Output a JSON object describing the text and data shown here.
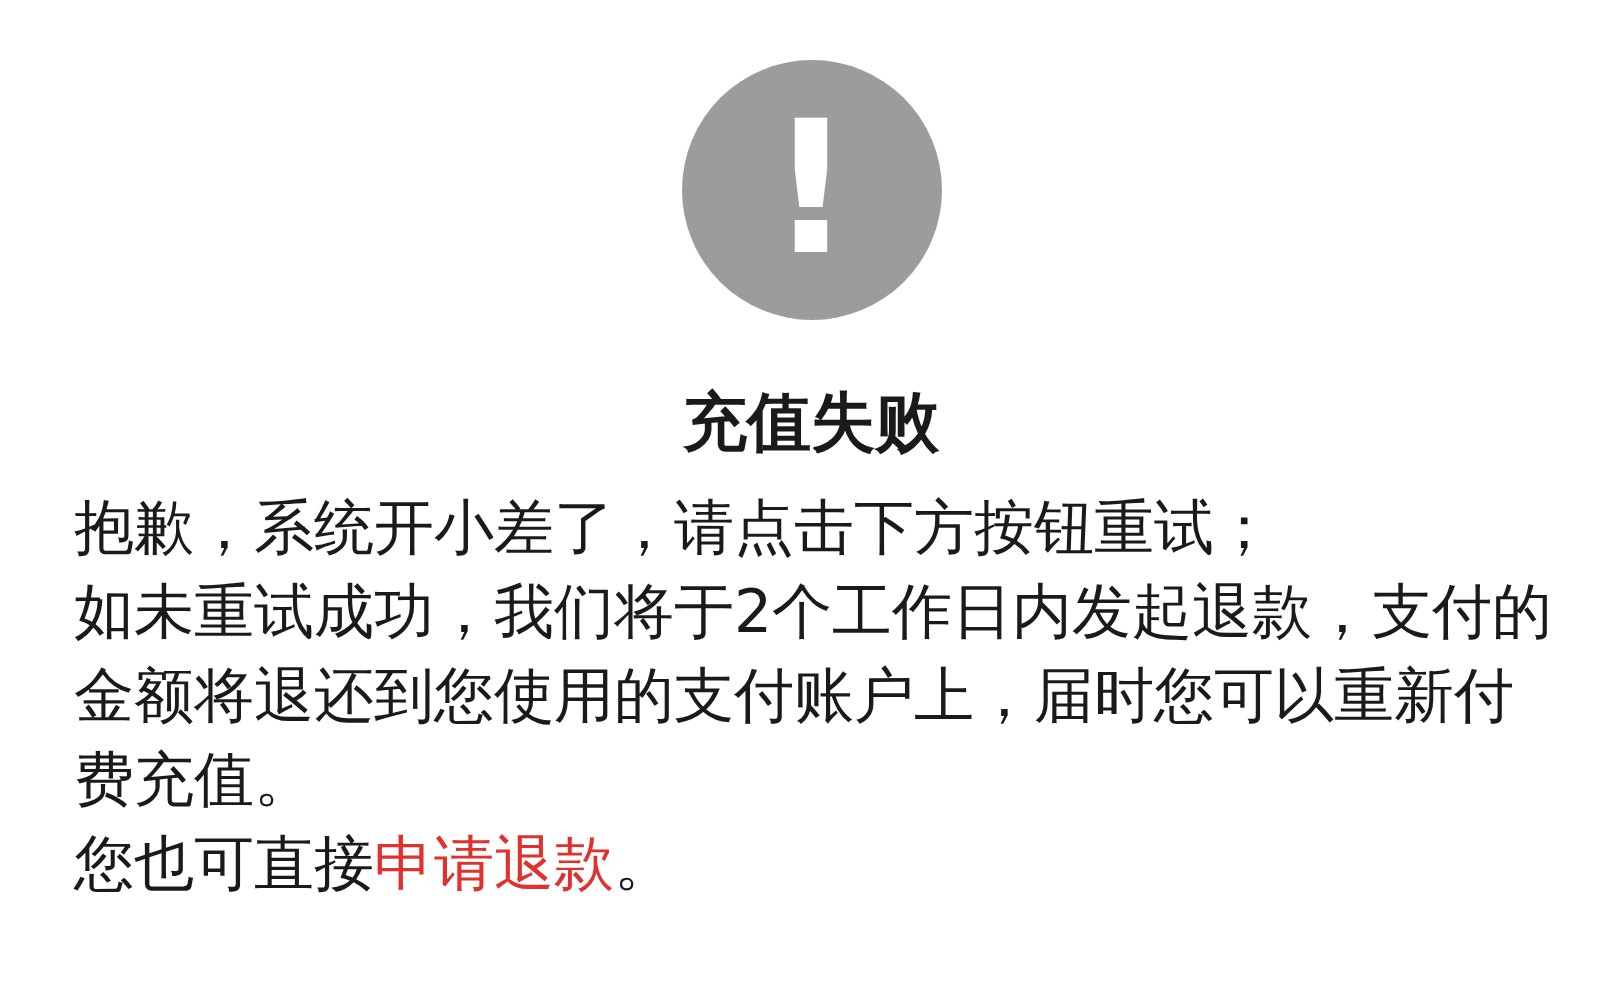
{
  "status_icon": {
    "symbol": "!"
  },
  "title": "充值失败",
  "paragraphs": [
    {
      "text": "抱歉，系统开小差了，请点击下方按钮重试；"
    },
    {
      "text": "如未重试成功，我们将于2个工作日内发起退款，支付的金额将退还到您使用的支付账户上，届时您可以重新付费充值。"
    },
    {
      "text": "您也可直接",
      "link": "申请退款",
      "after": "。"
    }
  ]
}
